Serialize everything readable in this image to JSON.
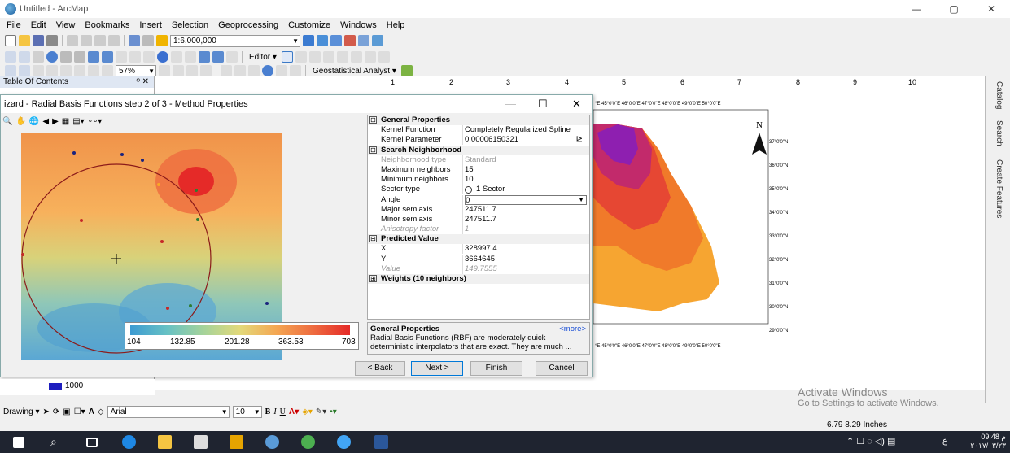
{
  "window": {
    "title": "Untitled - ArcMap",
    "controls": [
      "—",
      "▢",
      "✕"
    ]
  },
  "menu": [
    "File",
    "Edit",
    "View",
    "Bookmarks",
    "Insert",
    "Selection",
    "Geoprocessing",
    "Customize",
    "Windows",
    "Help"
  ],
  "toolbar": {
    "scale": "1:6,000,000",
    "editor_label": "Editor ▾",
    "zoom_percent": "57%",
    "geostat_label": "Geostatistical Analyst ▾"
  },
  "toc": {
    "title": "Table Of Contents",
    "pin": "ᵠ ✕",
    "legend_value": "1000"
  },
  "ruler": [
    "1",
    "2",
    "3",
    "4",
    "5",
    "6",
    "7",
    "8",
    "9",
    "10"
  ],
  "dialog": {
    "title": "Wizard - Radial Basis Functions step 2 of 3 - Method Properties",
    "title_visible": "izard - Radial Basis Functions step 2 of 3 - Method Properties",
    "legend_values": [
      "104",
      "132.85",
      "201.28",
      "363.53",
      "703"
    ],
    "properties": [
      {
        "type": "cat",
        "label": "General Properties",
        "toggle": "⊟"
      },
      {
        "type": "row",
        "name": "Kernel Function",
        "value": "Completely Regularized Spline"
      },
      {
        "type": "row",
        "name": "Kernel Parameter",
        "value": "0.00006150321"
      },
      {
        "type": "cat",
        "label": "Search Neighborhood",
        "toggle": "⊟"
      },
      {
        "type": "row",
        "name": "Neighborhood type",
        "value": "Standard",
        "grey": true
      },
      {
        "type": "row",
        "name": "Maximum neighbors",
        "value": "15"
      },
      {
        "type": "row",
        "name": "Minimum neighbors",
        "value": "10"
      },
      {
        "type": "row",
        "name": "Sector type",
        "value": "1 Sector"
      },
      {
        "type": "row",
        "name": "Angle",
        "value": "0"
      },
      {
        "type": "row",
        "name": "Major semiaxis",
        "value": "247511.7"
      },
      {
        "type": "row",
        "name": "Minor semiaxis",
        "value": "247511.7"
      },
      {
        "type": "row",
        "name": "Anisotropy factor",
        "value": "1",
        "grey": true,
        "italic": true
      },
      {
        "type": "cat",
        "label": "Predicted Value",
        "toggle": "⊟"
      },
      {
        "type": "row",
        "name": "X",
        "value": "328997.4"
      },
      {
        "type": "row",
        "name": "Y",
        "value": "3664645"
      },
      {
        "type": "row",
        "name": "Value",
        "value": "149.7555",
        "grey": true,
        "italic": true
      },
      {
        "type": "cat",
        "label": "Weights (10 neighbors)",
        "toggle": "⊞"
      }
    ],
    "desc_title": "General Properties",
    "desc_more": "<more>",
    "desc_text": "Radial Basis Functions (RBF) are moderately quick deterministic interpolators that are exact. They are much ...",
    "buttons": {
      "back": "< Back",
      "next": "Next >",
      "finish": "Finish",
      "cancel": "Cancel"
    }
  },
  "map": {
    "top_labels": "°E 45°0'0\"E 46°0'0\"E 47°0'0\"E 48°0'0\"E 49°0'0\"E 50°0'0\"E",
    "north": "N",
    "lat_labels": [
      "37°0'0\"N",
      "36°0'0\"N",
      "35°0'0\"N",
      "34°0'0\"N",
      "33°0'0\"N",
      "32°0'0\"N",
      "31°0'0\"N",
      "30°0'0\"N",
      "29°0'0\"N"
    ]
  },
  "right_tabs": [
    "Catalog",
    "Search",
    "Create Features"
  ],
  "drawing": {
    "label": "Drawing ▾",
    "font": "Arial",
    "size": "10",
    "bold": "B",
    "italic": "I",
    "underline": "U",
    "text_a": "A"
  },
  "status": {
    "coords": "6.79  8.29 Inches"
  },
  "watermark": {
    "line1": "Activate Windows",
    "line2": "Go to Settings to activate Windows."
  },
  "tray": {
    "time": "09:48 م",
    "date": "۲۰۱۷/۰۳/۲۳",
    "lang": "ع"
  }
}
